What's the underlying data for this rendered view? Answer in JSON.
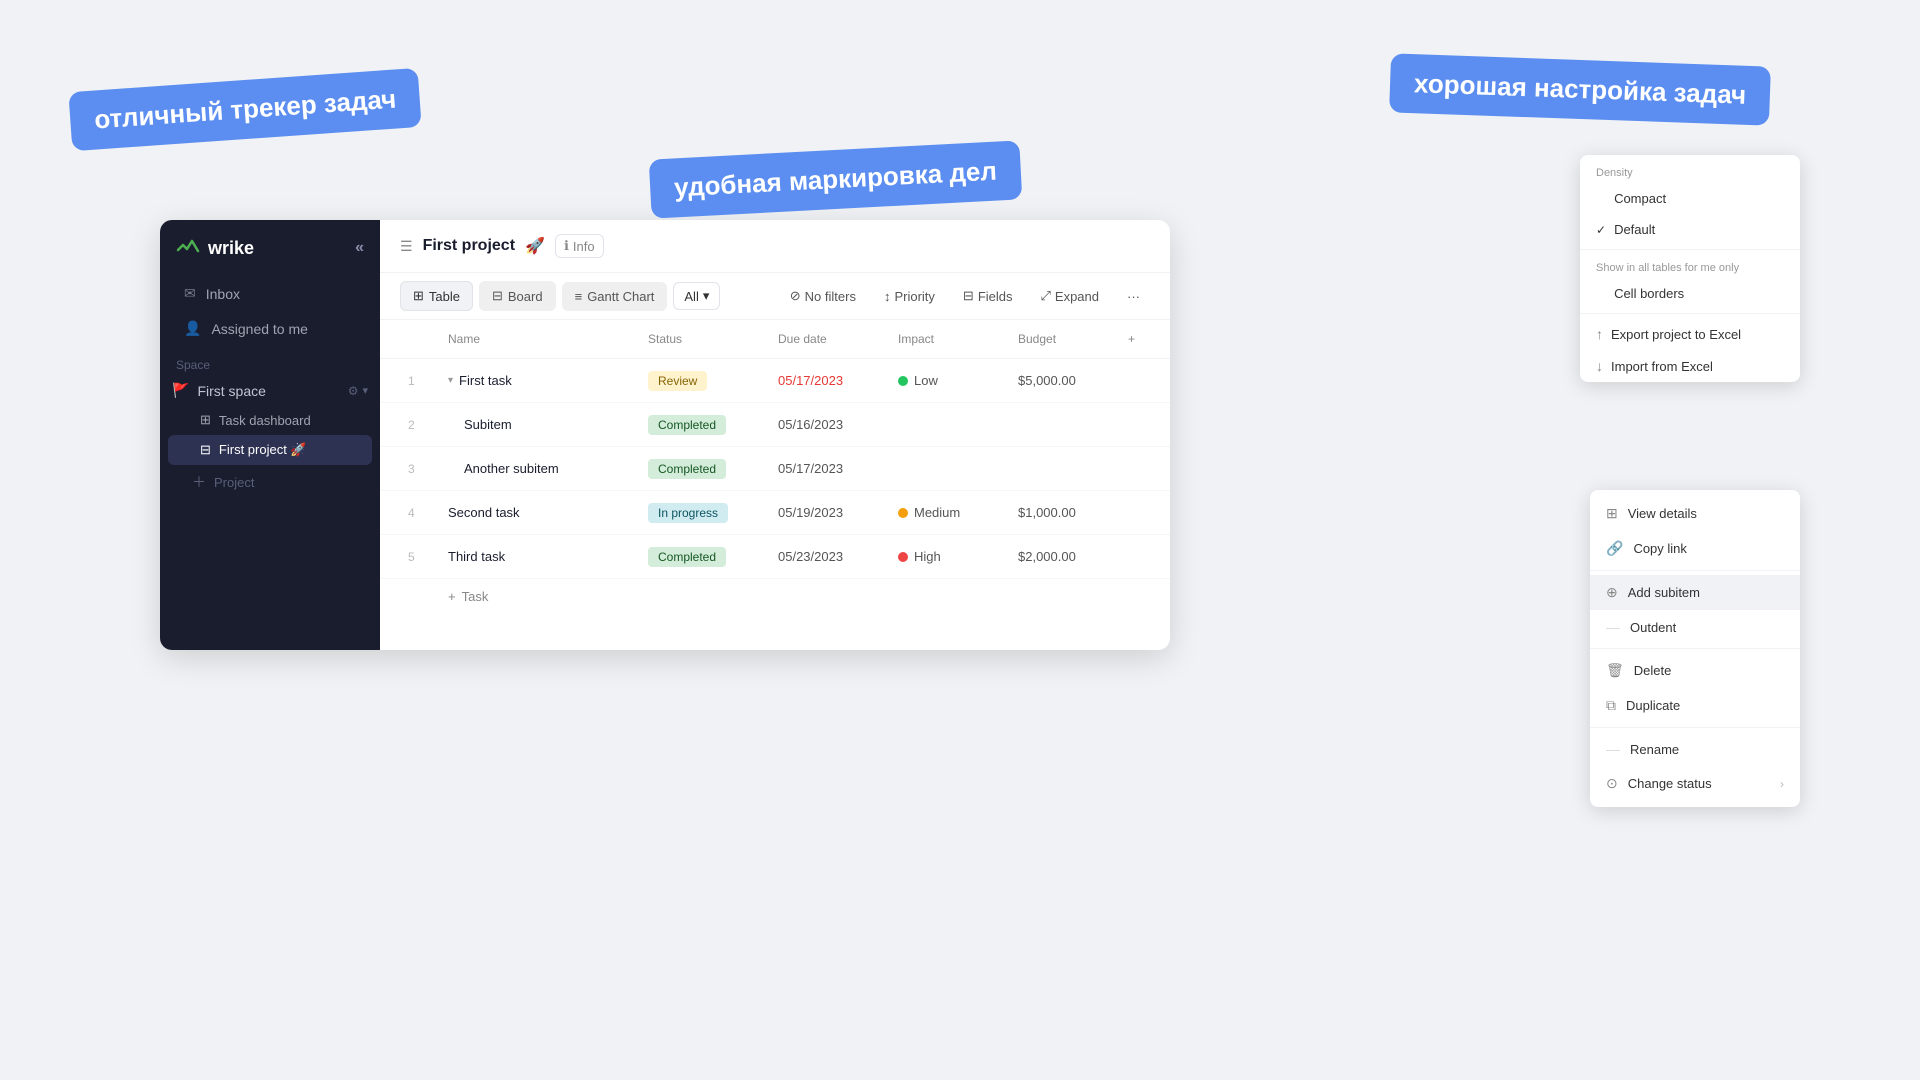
{
  "bubbles": {
    "left": "отличный трекер задач",
    "center": "удобная маркировка дел",
    "right": "хорошая настройка задач"
  },
  "sidebar": {
    "logo": "wrike",
    "nav": [
      {
        "label": "Inbox",
        "icon": "✉"
      },
      {
        "label": "Assigned to me",
        "icon": "👤"
      }
    ],
    "section_label": "Space",
    "space": {
      "name": "First space",
      "icon": "🚩"
    },
    "sub_items": [
      {
        "label": "Task dashboard",
        "icon": "⊞"
      },
      {
        "label": "First project 🚀",
        "icon": "⊟",
        "active": true
      }
    ],
    "add_project": "Project"
  },
  "project": {
    "title": "First project",
    "rocket": "🚀",
    "info_label": "Info"
  },
  "toolbar": {
    "tabs": [
      {
        "label": "Table",
        "icon": "⊞",
        "active": true
      },
      {
        "label": "Board",
        "icon": "⊟"
      },
      {
        "label": "Gantt Chart",
        "icon": "≡"
      }
    ],
    "all_label": "All",
    "filters_label": "No filters",
    "priority_label": "Priority",
    "fields_label": "Fields",
    "expand_label": "Expand"
  },
  "table": {
    "columns": [
      "",
      "Name",
      "Status",
      "Due date",
      "Impact",
      "Budget",
      "+"
    ],
    "rows": [
      {
        "num": "1",
        "name": "First task",
        "expandable": true,
        "status": "Review",
        "status_class": "review",
        "due_date": "05/17/2023",
        "due_overdue": true,
        "impact": "Low",
        "impact_dot": "green",
        "budget": "$5,000.00"
      },
      {
        "num": "2",
        "name": "Subitem",
        "subitem": true,
        "status": "Completed",
        "status_class": "completed",
        "due_date": "05/16/2023",
        "due_overdue": false,
        "impact": "",
        "impact_dot": "",
        "budget": ""
      },
      {
        "num": "3",
        "name": "Another subitem",
        "subitem": true,
        "status": "Completed",
        "status_class": "completed",
        "due_date": "05/17/2023",
        "due_overdue": false,
        "impact": "",
        "impact_dot": "",
        "budget": ""
      },
      {
        "num": "4",
        "name": "Second task",
        "subitem": false,
        "status": "In progress",
        "status_class": "inprogress",
        "due_date": "05/19/2023",
        "due_overdue": false,
        "impact": "Medium",
        "impact_dot": "yellow",
        "budget": "$1,000.00"
      },
      {
        "num": "5",
        "name": "Third task",
        "subitem": false,
        "status": "Completed",
        "status_class": "completed",
        "due_date": "05/23/2023",
        "due_overdue": false,
        "impact": "High",
        "impact_dot": "red",
        "budget": "$2,000.00"
      }
    ],
    "add_task_label": "Task"
  },
  "density_dropdown": {
    "section_label": "Density",
    "items": [
      {
        "label": "Compact",
        "checked": false
      },
      {
        "label": "Default",
        "checked": true
      }
    ],
    "section2_label": "Show in all tables for me only",
    "cell_borders": "Cell borders",
    "export_label": "Export project to Excel",
    "import_label": "Import from Excel"
  },
  "context_menu": {
    "items": [
      {
        "label": "View details",
        "icon": "⊞"
      },
      {
        "label": "Copy link",
        "icon": "🔗"
      },
      {
        "label": "Add subitem",
        "icon": "⊕",
        "highlighted": true
      },
      {
        "label": "Outdent",
        "icon": ""
      },
      {
        "label": "Delete",
        "icon": "🗑"
      },
      {
        "label": "Duplicate",
        "icon": "⧉"
      },
      {
        "label": "Rename",
        "icon": ""
      },
      {
        "label": "Change status",
        "icon": "⊙",
        "has_arrow": true
      }
    ]
  }
}
